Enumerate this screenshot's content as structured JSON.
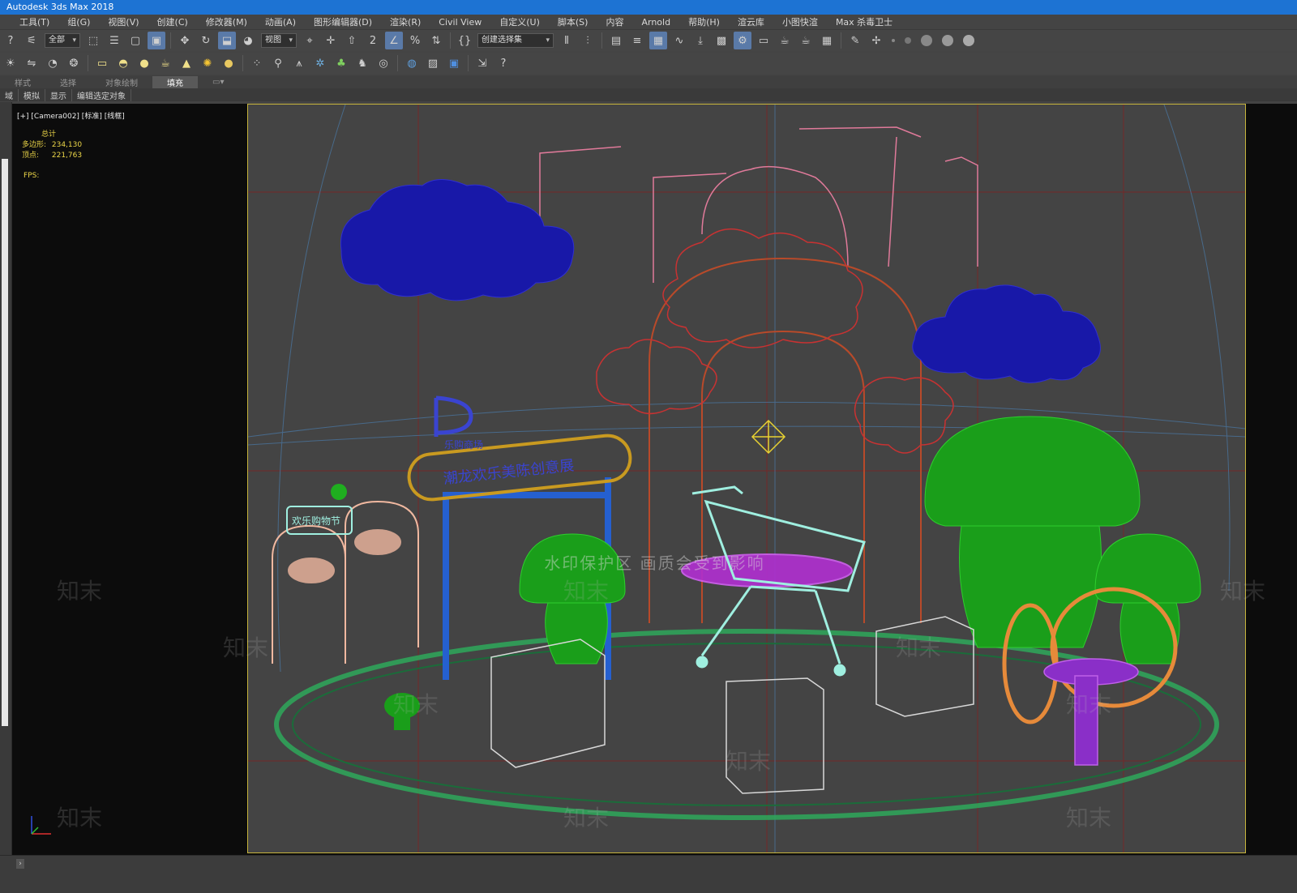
{
  "window": {
    "title": "Autodesk 3ds Max 2018"
  },
  "menu": [
    "工具(T)",
    "组(G)",
    "视图(V)",
    "创建(C)",
    "修改器(M)",
    "动画(A)",
    "图形编辑器(D)",
    "渲染(R)",
    "Civil View",
    "自定义(U)",
    "脚本(S)",
    "内容",
    "Arnold",
    "帮助(H)",
    "渲云库",
    "小图快渲",
    "Max 杀毒卫士"
  ],
  "toolbar": {
    "filter_dropdown": "全部",
    "coord_dropdown": "视图",
    "selection_set_dropdown": "创建选择集",
    "snap_label": "2"
  },
  "ribbon": {
    "tabs": [
      "样式",
      "选择",
      "对象绘制",
      "填充"
    ],
    "active_tab": "填充",
    "subtabs": [
      "域",
      "模拟",
      "显示",
      "编辑选定对象"
    ]
  },
  "viewport": {
    "label": "[+] [Camera002] [标准] [线框]",
    "stats": {
      "header": "总计",
      "polys_label": "多边形:",
      "polys_value": "234,130",
      "verts_label": "顶点:",
      "verts_value": "221,763",
      "fps_label": "FPS:"
    }
  },
  "watermark": {
    "band_text": "水印保护区   画质会受到影响",
    "tile_text": "知末"
  },
  "scene": {
    "signboard_text": "潮龙欢乐美陈创意展",
    "sign_small_text": "乐购商场",
    "booth_sign_text": "欢乐购物节"
  },
  "colors": {
    "title_bar": "#1d73d3",
    "safe_frame": "#c7b53c",
    "cloud": "#1818a8",
    "mushroom": "#1fae1f",
    "track": "#2ea85a",
    "cart": "#9fefe0",
    "arch": "#b84a2a",
    "ring": "#e68a3a",
    "table": "#b12fd1",
    "grid_red": "#8a1c1c"
  }
}
